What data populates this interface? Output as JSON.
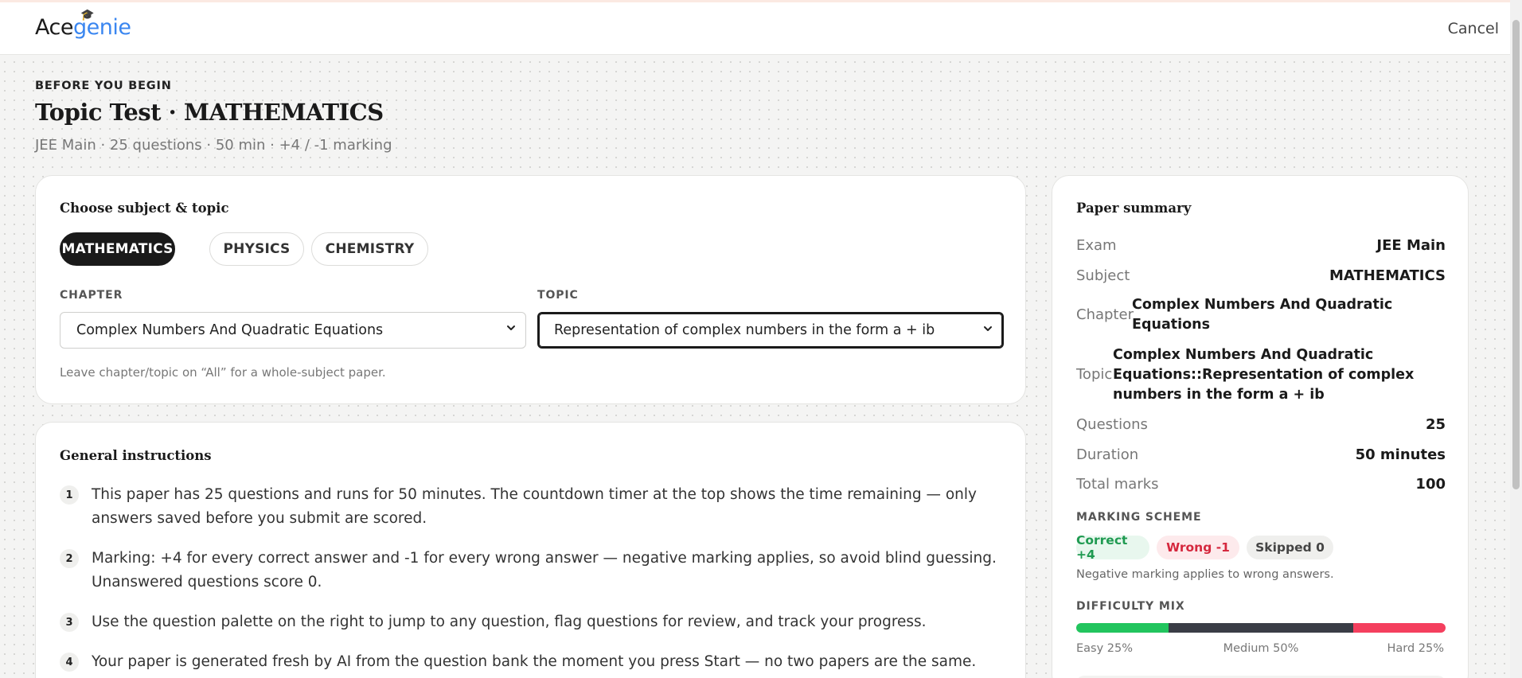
{
  "header": {
    "logo_ace": "Ace",
    "logo_genie": "genie",
    "cancel_label": "Cancel"
  },
  "intro": {
    "eyebrow": "BEFORE YOU BEGIN",
    "title": "Topic Test · MATHEMATICS",
    "subtitle": "JEE Main · 25 questions · 50 min · +4 / -1 marking"
  },
  "choose": {
    "title": "Choose subject & topic",
    "subjects": [
      {
        "label": "MATHEMATICS",
        "active": true
      },
      {
        "label": "PHYSICS",
        "active": false
      },
      {
        "label": "CHEMISTRY",
        "active": false
      }
    ],
    "chapter_label": "CHAPTER",
    "chapter_value": "Complex Numbers And Quadratic Equations",
    "topic_label": "TOPIC",
    "topic_value": "Representation of complex numbers in the form a + ib",
    "hint": "Leave chapter/topic on “All” for a whole-subject paper."
  },
  "instructions": {
    "title": "General instructions",
    "items": [
      {
        "num": "1",
        "text": "This paper has 25 questions and runs for 50 minutes. The countdown timer at the top shows the time remaining — only answers saved before you submit are scored."
      },
      {
        "num": "2",
        "text": "Marking: +4 for every correct answer and -1 for every wrong answer — negative marking applies, so avoid blind guessing. Unanswered questions score 0."
      },
      {
        "num": "3",
        "text": "Use the question palette on the right to jump to any question, flag questions for review, and track your progress."
      },
      {
        "num": "4",
        "text": "Your paper is generated fresh by AI from the question bank the moment you press Start — no two papers are the same."
      }
    ]
  },
  "summary": {
    "title": "Paper summary",
    "exam_k": "Exam",
    "exam_v": "JEE Main",
    "subject_k": "Subject",
    "subject_v": "MATHEMATICS",
    "chapter_k": "Chapter",
    "chapter_v": "Complex Numbers And Quadratic Equations",
    "topic_k": "Topic",
    "topic_v": "Complex Numbers And Quadratic Equations::Representation of complex numbers in the form a + ib",
    "questions_k": "Questions",
    "questions_v": "25",
    "duration_k": "Duration",
    "duration_v": "50 minutes",
    "marks_k": "Total marks",
    "marks_v": "100",
    "marking_title": "MARKING SCHEME",
    "correct_badge": "Correct +4",
    "wrong_badge": "Wrong -1",
    "skipped_badge": "Skipped 0",
    "negative_note": "Negative marking applies to wrong answers.",
    "difficulty_title": "DIFFICULTY MIX",
    "difficulty": [
      {
        "label": "Easy 25%",
        "pct": 25,
        "color": "#22c55e"
      },
      {
        "label": "Medium 50%",
        "pct": 50,
        "color": "#3a3d46"
      },
      {
        "label": "Hard 25%",
        "pct": 25,
        "color": "#f43f5e"
      }
    ]
  }
}
